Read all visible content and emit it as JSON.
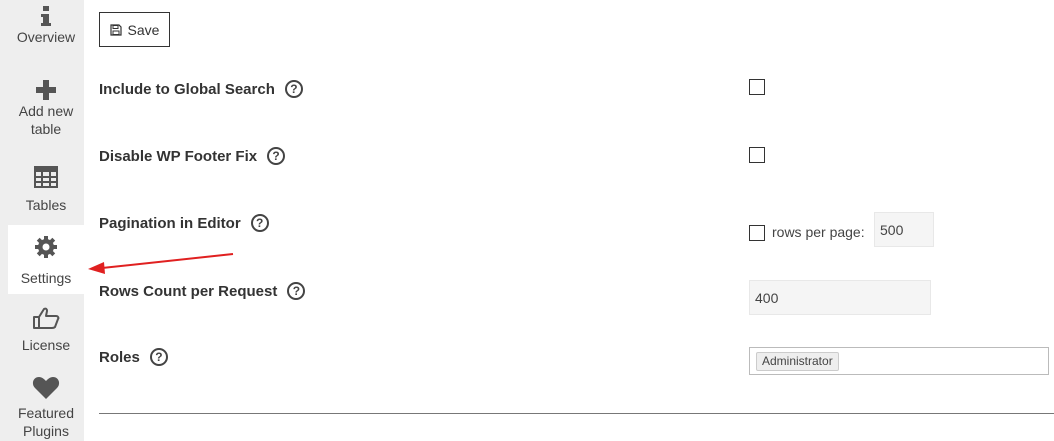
{
  "sidebar": {
    "items": [
      {
        "label_lines": [
          "Overview"
        ],
        "icon": "info-icon"
      },
      {
        "label_lines": [
          "Add new",
          "table"
        ],
        "icon": "plus-icon"
      },
      {
        "label_lines": [
          "Tables"
        ],
        "icon": "table-grid-icon"
      },
      {
        "label_lines": [
          "Settings"
        ],
        "icon": "gear-icon",
        "active": true
      },
      {
        "label_lines": [
          "License"
        ],
        "icon": "thumbs-up-icon"
      },
      {
        "label_lines": [
          "Featured",
          "Plugins"
        ],
        "icon": "heart-icon"
      }
    ]
  },
  "toolbar": {
    "save_label": "Save",
    "save_icon": "floppy-disk-icon"
  },
  "settings": {
    "global_search": {
      "label": "Include to Global Search",
      "help": "?",
      "checked": false
    },
    "footer_fix": {
      "label": "Disable WP Footer Fix",
      "help": "?",
      "checked": false
    },
    "pagination": {
      "label": "Pagination in Editor",
      "help": "?",
      "checked": false,
      "rows_label": "rows per page:",
      "rows_value": "500"
    },
    "rows_count": {
      "label": "Rows Count per Request",
      "help": "?",
      "value": "400"
    },
    "roles": {
      "label": "Roles",
      "help": "?",
      "selected": [
        "Administrator"
      ]
    }
  },
  "annotation": {
    "arrow_color": "#e02020"
  }
}
